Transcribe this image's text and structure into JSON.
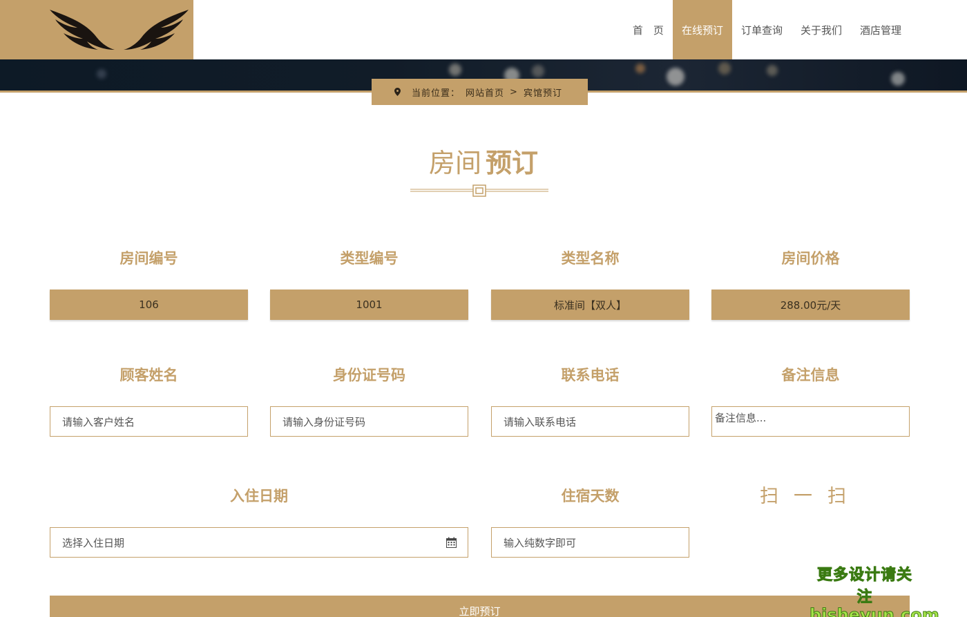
{
  "nav": {
    "items": [
      "首　页",
      "在线预订",
      "订单查询",
      "关于我们",
      "酒店管理"
    ],
    "active_index": 1
  },
  "breadcrumb": {
    "prefix": "当前位置：",
    "home": "网站首页",
    "separator": ">",
    "current": "宾馆预订"
  },
  "title": {
    "light": "房间",
    "bold": "预订"
  },
  "room": {
    "room_no_label": "房间编号",
    "room_no": "106",
    "type_no_label": "类型编号",
    "type_no": "1001",
    "type_name_label": "类型名称",
    "type_name": "标准间【双人】",
    "price_label": "房间价格",
    "price": "288.00元/天"
  },
  "form": {
    "name_label": "顾客姓名",
    "name_placeholder": "请输入客户姓名",
    "id_label": "身份证号码",
    "id_placeholder": "请输入身份证号码",
    "phone_label": "联系电话",
    "phone_placeholder": "请输入联系电话",
    "note_label": "备注信息",
    "note_placeholder": "备注信息...",
    "checkin_label": "入住日期",
    "checkin_placeholder": "选择入住日期",
    "days_label": "住宿天数",
    "days_placeholder": "输入纯数字即可",
    "scan_label": "扫一扫",
    "submit_label": "立即预订"
  },
  "watermark": {
    "line1": "更多设计请关注",
    "line2": "bisheyun.com"
  },
  "colors": {
    "accent": "#c4a06a",
    "banner_dark": "#111c28"
  }
}
